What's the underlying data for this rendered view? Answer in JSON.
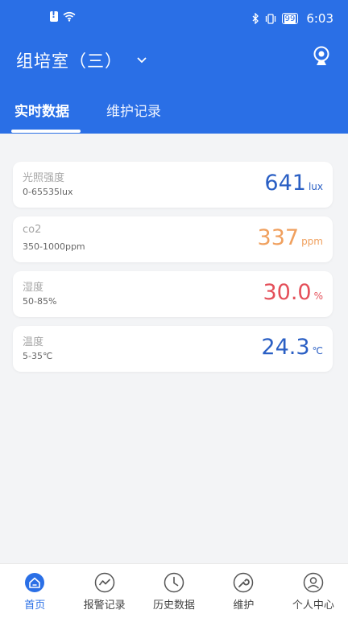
{
  "status_bar": {
    "battery": "99",
    "time": "6:03"
  },
  "header": {
    "title": "组培室（三）",
    "tabs": [
      {
        "label": "实时数据",
        "active": true
      },
      {
        "label": "维护记录",
        "active": false
      }
    ]
  },
  "sensors": [
    {
      "name": "光照强度",
      "range": "0-65535lux",
      "value": "641",
      "unit": "lux",
      "color": "#2a5fc4"
    },
    {
      "name": "co2",
      "range": "350-1000ppm",
      "value": "337",
      "unit": "ppm",
      "color": "#f0a05e"
    },
    {
      "name": "湿度",
      "range": "50-85%",
      "value": "30.0",
      "unit": "%",
      "color": "#e4505a"
    },
    {
      "name": "温度",
      "range": "5-35℃",
      "value": "24.3",
      "unit": "℃",
      "color": "#2a5fc4"
    }
  ],
  "bottom_nav": [
    {
      "label": "首页",
      "icon": "home-icon",
      "active": true
    },
    {
      "label": "报警记录",
      "icon": "trend-icon",
      "active": false
    },
    {
      "label": "历史数据",
      "icon": "clock-icon",
      "active": false
    },
    {
      "label": "维护",
      "icon": "wrench-icon",
      "active": false
    },
    {
      "label": "个人中心",
      "icon": "user-icon",
      "active": false
    }
  ],
  "colors": {
    "brand": "#2a6fe6",
    "background": "#f3f4f6"
  }
}
